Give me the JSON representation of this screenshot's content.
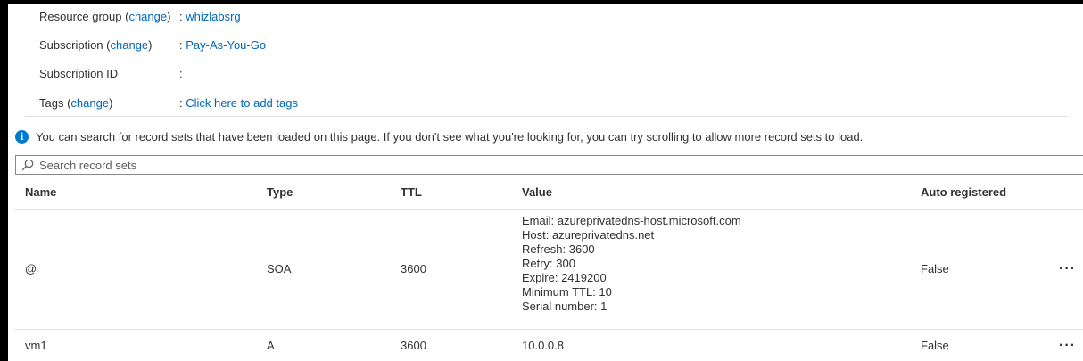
{
  "essentials": {
    "resource_group": {
      "label": "Resource group",
      "change": "change",
      "value": "whizlabsrg"
    },
    "subscription": {
      "label": "Subscription",
      "change": "change",
      "value": "Pay-As-You-Go"
    },
    "subscription_id": {
      "label": "Subscription ID",
      "value": ""
    },
    "tags": {
      "label": "Tags",
      "change": "change",
      "value": "Click here to add tags"
    }
  },
  "info_banner": {
    "text": "You can search for record sets that have been loaded on this page. If you don't see what you're looking for, you can try scrolling to allow more record sets to load."
  },
  "search": {
    "placeholder": "Search record sets"
  },
  "table": {
    "columns": [
      "Name",
      "Type",
      "TTL",
      "Value",
      "Auto registered"
    ],
    "rows": [
      {
        "name": "@",
        "type": "SOA",
        "ttl": "3600",
        "value": [
          "Email: azureprivatedns-host.microsoft.com",
          "Host: azureprivatedns.net",
          "Refresh: 3600",
          "Retry: 300",
          "Expire: 2419200",
          "Minimum TTL: 10",
          "Serial number: 1"
        ],
        "auto_registered": "False",
        "more": "···"
      },
      {
        "name": "vm1",
        "type": "A",
        "ttl": "3600",
        "value": [
          "10.0.0.8"
        ],
        "auto_registered": "False",
        "more": "···"
      }
    ]
  },
  "colors": {
    "link": "#0067b8",
    "info_icon": "#0078d4",
    "divider": "#e1dfdd"
  }
}
